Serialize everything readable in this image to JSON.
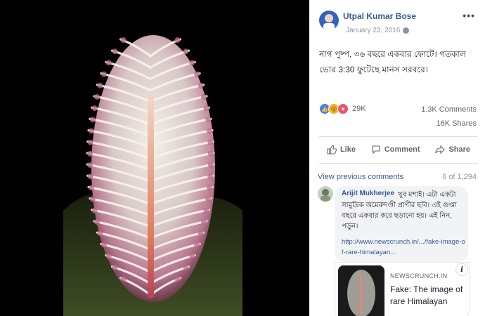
{
  "post": {
    "author": "Utpal Kumar Bose",
    "date": "January 23, 2016",
    "text": "নাগ পুষ্প, ৩৬ বছরে একবার ফোটে। গতকাল ভোর 3:30 ফুটেছে মানস সরবরে।",
    "more_icon": "•••"
  },
  "reactions": {
    "count": "29K",
    "like_glyph": "👍",
    "wow_glyph": "😮",
    "love_glyph": "♥"
  },
  "stats": {
    "comments": "1.3K Comments",
    "shares": "16K Shares"
  },
  "actions": {
    "like": "Like",
    "comment": "Comment",
    "share": "Share"
  },
  "comments": {
    "view_previous": "View previous comments",
    "count": "6 of 1,294",
    "items": [
      {
        "author": "Arijit Mukherjee",
        "text": "খুব মশাই। এটা একটা সামুদ্রিক অমেরুদণ্ডী প্রাণীর ছবি। এই গুপ্তা বছরে একবার করে ছড়ানো হয়। এই নিন, পড়ুন।",
        "link": "http://www.newscrunch.in/.../fake-image-of-rare-himalayan..."
      }
    ]
  },
  "link_card": {
    "source": "NEWSCRUNCH.IN",
    "title": "Fake: The image of rare Himalayan",
    "info": "i"
  },
  "colors": {
    "link_blue": "#385898",
    "photo_bg": "#000000"
  }
}
